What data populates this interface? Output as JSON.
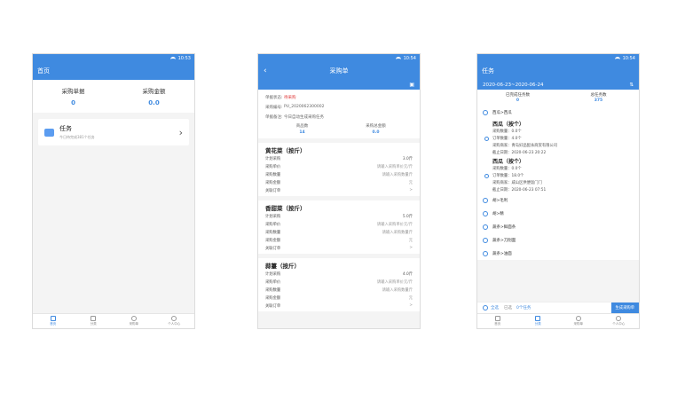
{
  "status_time": [
    "10:53",
    "10:54",
    "10:54"
  ],
  "home": {
    "title": "首页",
    "stats": [
      {
        "label": "采购单据",
        "value": "0"
      },
      {
        "label": "采购金额",
        "value": "0.0"
      }
    ],
    "task": {
      "title": "任务",
      "subtitle": "今日待完成381个任务"
    }
  },
  "order": {
    "title": "采购单",
    "info": [
      {
        "label": "单据状态:",
        "value": "待采购"
      },
      {
        "label": "采购编号:",
        "value": "PU_2020062300002"
      },
      {
        "label": "单据备注:",
        "value": "今日自动生成采购任务"
      }
    ],
    "sums": [
      {
        "label": "商品数",
        "value": "14"
      },
      {
        "label": "采购总金额",
        "value": "0.0"
      }
    ],
    "items": [
      {
        "name": "黄花菜（按斤）",
        "lines": [
          {
            "k": "计划采购",
            "v": "3.0斤"
          },
          {
            "k": "采购单价",
            "v": "请输入采购单价元/斤"
          },
          {
            "k": "采购数量",
            "v": "请输入采购数量斤"
          },
          {
            "k": "采购金额",
            "v": "元"
          },
          {
            "k": "关联订单",
            "v": ">"
          }
        ]
      },
      {
        "name": "香甜菜（按斤）",
        "lines": [
          {
            "k": "计划采购",
            "v": "5.0斤"
          },
          {
            "k": "采购单价",
            "v": "请输入采购单价元/斤"
          },
          {
            "k": "采购数量",
            "v": "请输入采购数量斤"
          },
          {
            "k": "采购金额",
            "v": "元"
          },
          {
            "k": "关联订单",
            "v": ">"
          }
        ]
      },
      {
        "name": "蒜薹（按斤）",
        "lines": [
          {
            "k": "计划采购",
            "v": "4.0斤"
          },
          {
            "k": "采购单价",
            "v": "请输入采购单价元/斤"
          },
          {
            "k": "采购数量",
            "v": "请输入采购数量斤"
          },
          {
            "k": "采购金额",
            "v": "元"
          },
          {
            "k": "关联订单",
            "v": ">"
          }
        ]
      }
    ]
  },
  "tasks": {
    "title": "任务",
    "date_range": "2020-06-23~2020-06-24",
    "sums": [
      {
        "label": "已完成任务数",
        "value": "0"
      },
      {
        "label": "总任务数",
        "value": "375"
      }
    ],
    "first": "西瓜>西瓜",
    "details": [
      {
        "title": "西瓜（按个）",
        "lines": [
          "采购数量：0.0个",
          "订单数量：4.0个",
          "采购商家：青岛好品配永商贸有限公司",
          "截止日期：2020-06-23 20:22"
        ]
      },
      {
        "title": "西瓜（按个）",
        "lines": [
          "采购数量：0.0个",
          "订单数量：18.0个",
          "采购商家：咸山区供便饭门门",
          "截止日期：2020-06-23 07:51"
        ]
      }
    ],
    "rows": [
      "胡>毛利",
      "胡>精",
      "蔬条>鲜面条",
      "蔬条>刀削面",
      "蔬条>油面"
    ],
    "select_all": "全选",
    "selected_info": "已选",
    "selected_count": "0个任务",
    "generate": "生成采购单"
  },
  "tabs": [
    "首页",
    "分类",
    "采购单",
    "个人中心"
  ]
}
